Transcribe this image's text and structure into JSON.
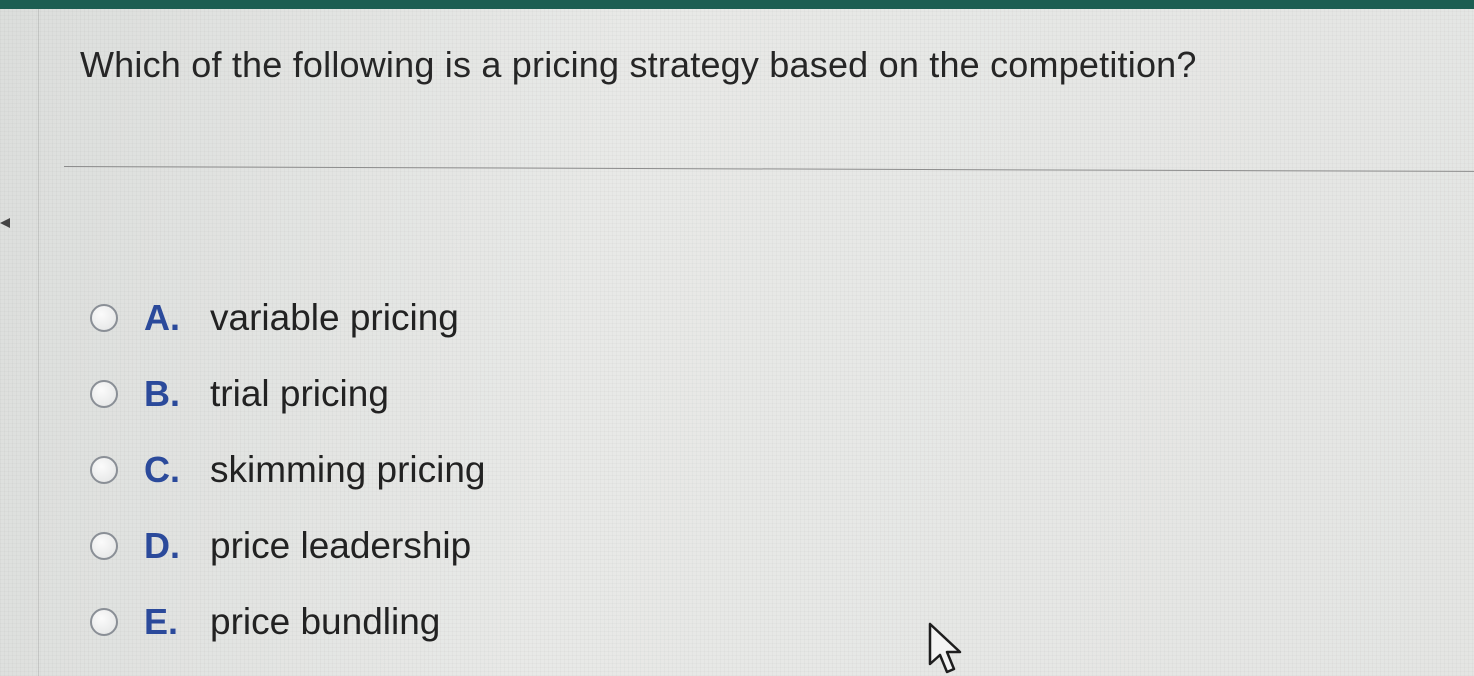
{
  "question": {
    "text": "Which of the following is a pricing strategy based on the competition?"
  },
  "options": [
    {
      "letter": "A.",
      "text": "variable pricing"
    },
    {
      "letter": "B.",
      "text": "trial pricing"
    },
    {
      "letter": "C.",
      "text": "skimming pricing"
    },
    {
      "letter": "D.",
      "text": "price leadership"
    },
    {
      "letter": "E.",
      "text": "price bundling"
    }
  ],
  "colors": {
    "top_bar": "#1c5e52",
    "option_letter": "#2b4a9b",
    "background": "#e6e7e5"
  },
  "icons": {
    "pointer": "mouse-cursor-icon"
  }
}
